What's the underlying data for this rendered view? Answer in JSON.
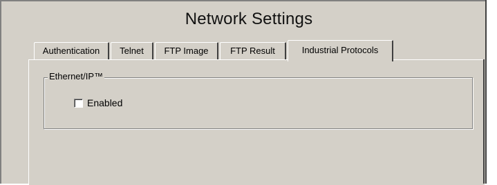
{
  "window": {
    "title": "Network Settings"
  },
  "tabs": [
    {
      "label": "Authentication",
      "active": false
    },
    {
      "label": "Telnet",
      "active": false
    },
    {
      "label": "FTP Image",
      "active": false
    },
    {
      "label": "FTP Result",
      "active": false
    },
    {
      "label": "Industrial Protocols",
      "active": true
    }
  ],
  "panel": {
    "group_title": "Ethernet/IP™",
    "enabled_checkbox": {
      "label": "Enabled",
      "checked": false
    }
  },
  "colors": {
    "dialog_background": "#d4d0c8",
    "shadow": "#808080",
    "dark_shadow": "#404040",
    "highlight": "#ffffff"
  }
}
